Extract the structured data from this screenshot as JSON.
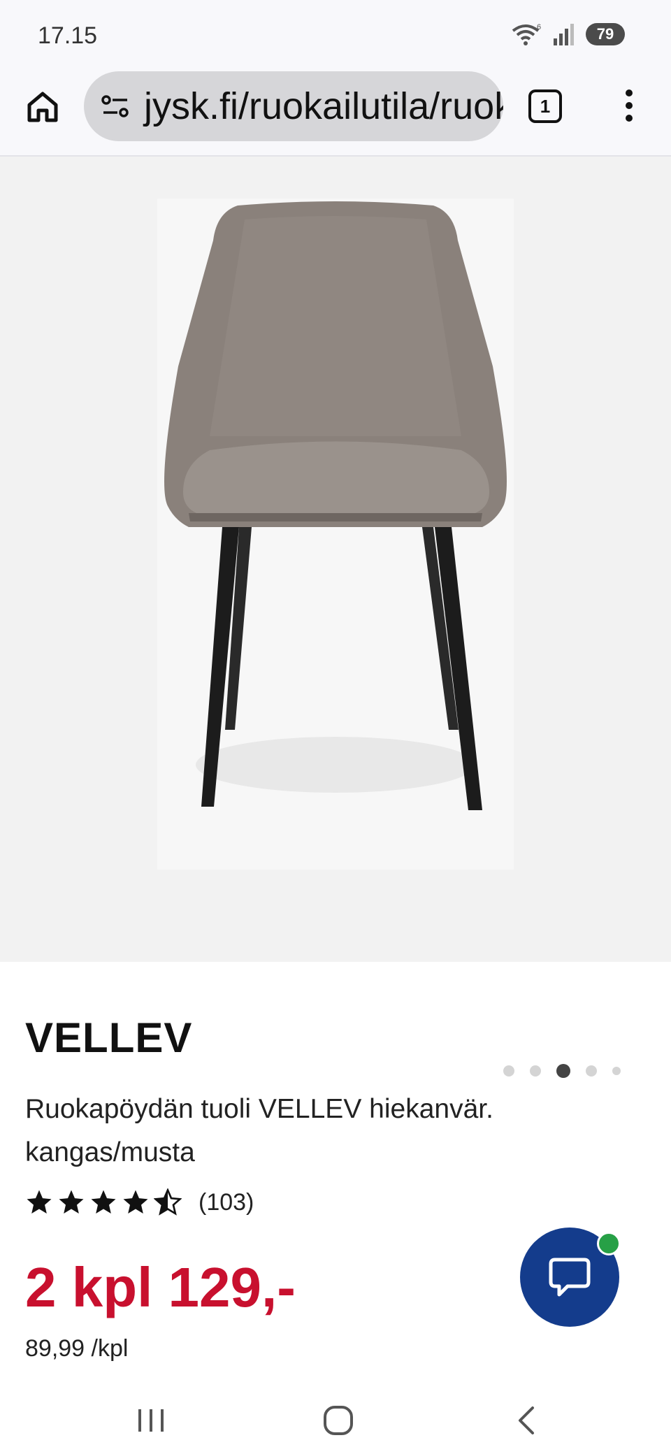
{
  "status": {
    "time": "17.15",
    "battery": "79",
    "wifi_badge": "6"
  },
  "browser": {
    "url": "jysk.fi/ruokailutila/ruokapoydan-tuolit",
    "tab_count": "1"
  },
  "gallery": {
    "image_subject": "dining-chair",
    "slide_count": 5,
    "active_slide": 3
  },
  "product": {
    "name": "VELLEV",
    "description": "Ruokapöydän tuoli VELLEV hiekanvär. kangas/musta",
    "rating": 4.5,
    "review_count": "(103)",
    "price": "2 kpl 129,-",
    "unit_price": "89,99 /kpl"
  },
  "colors": {
    "price": "#c8102e",
    "chat_button": "#143c8c",
    "online_indicator": "#27a046"
  },
  "icons": {
    "home": "home-icon",
    "site_info": "site-settings-icon",
    "tabs": "tabs-icon",
    "menu": "more-vert-icon",
    "chat": "chat-bubble-icon",
    "nav_recent": "recent-apps-icon",
    "nav_home": "nav-home-icon",
    "nav_back": "back-icon"
  }
}
